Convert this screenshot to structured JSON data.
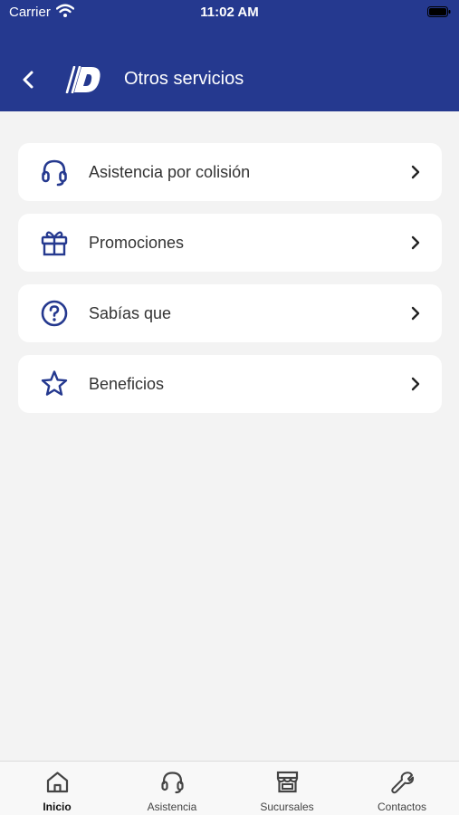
{
  "colors": {
    "brand": "#25398f",
    "background": "#f3f3f3",
    "card": "#ffffff",
    "text": "#333333"
  },
  "status_bar": {
    "carrier": "Carrier",
    "time": "11:02 AM"
  },
  "header": {
    "title": "Otros servicios",
    "back_icon": "chevron-left-icon",
    "logo": "brand-logo"
  },
  "menu": {
    "items": [
      {
        "label": "Asistencia por colisión",
        "icon": "headset-icon"
      },
      {
        "label": "Promociones",
        "icon": "gift-icon"
      },
      {
        "label": "Sabías que",
        "icon": "question-circle-icon"
      },
      {
        "label": "Beneficios",
        "icon": "star-icon"
      }
    ]
  },
  "tabbar": {
    "items": [
      {
        "label": "Inicio",
        "icon": "home-icon",
        "active": true
      },
      {
        "label": "Asistencia",
        "icon": "headset-icon",
        "active": false
      },
      {
        "label": "Sucursales",
        "icon": "store-icon",
        "active": false
      },
      {
        "label": "Contactos",
        "icon": "wrench-icon",
        "active": false
      }
    ]
  }
}
